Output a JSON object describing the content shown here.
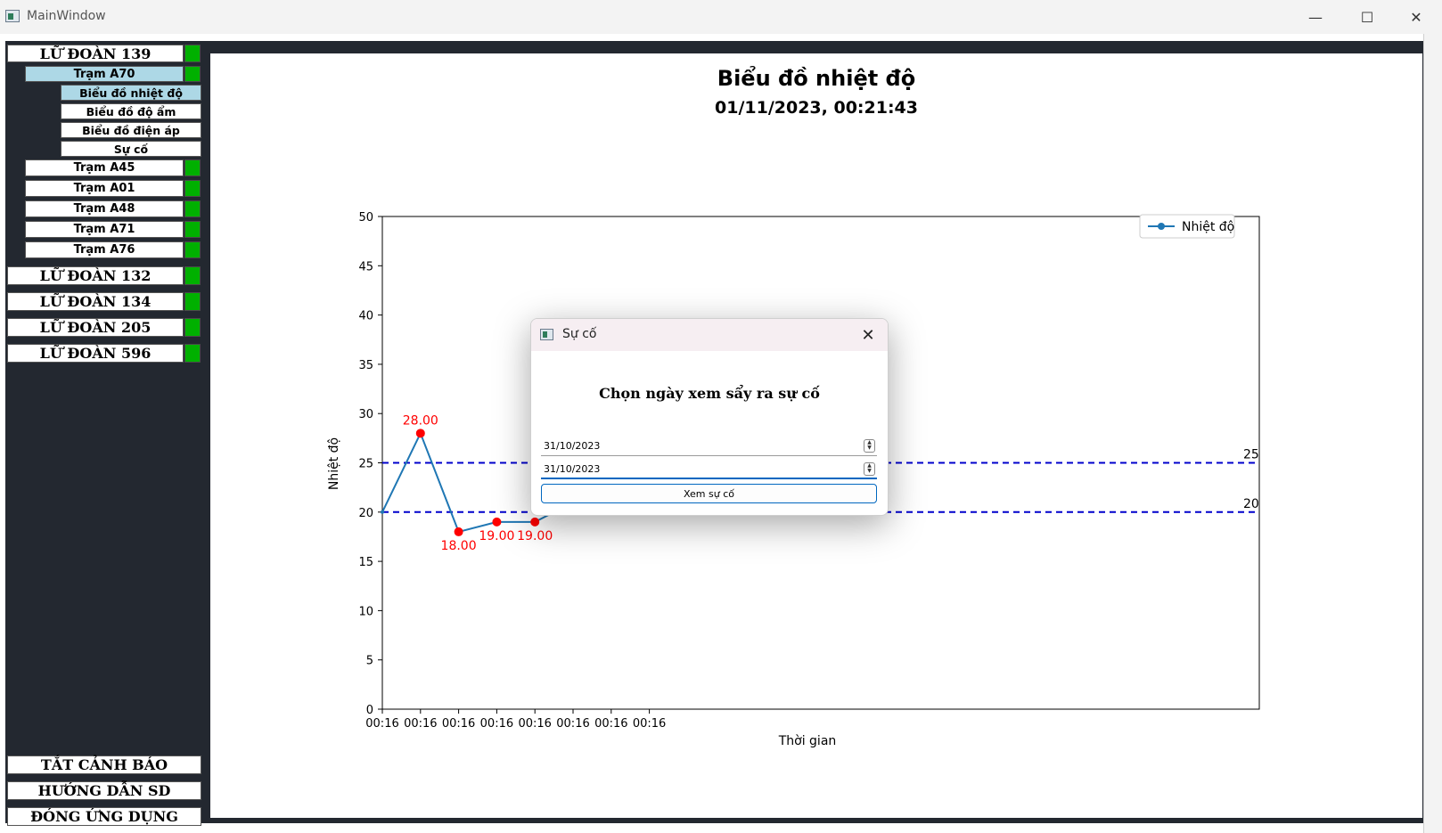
{
  "window": {
    "title": "MainWindow",
    "minimize_icon": "—",
    "maximize_icon": "☐",
    "close_icon": "✕"
  },
  "sidebar": {
    "groups": [
      {
        "label": "LỮ ĐOÀN 139"
      },
      {
        "label": "LỮ ĐOÀN 132"
      },
      {
        "label": "LỮ ĐOÀN 134"
      },
      {
        "label": "LỮ ĐOÀN 205"
      },
      {
        "label": "LỮ ĐOÀN 596"
      }
    ],
    "stations": [
      {
        "label": "Trạm A70"
      },
      {
        "label": "Trạm A45"
      },
      {
        "label": "Trạm A01"
      },
      {
        "label": "Trạm A48"
      },
      {
        "label": "Trạm A71"
      },
      {
        "label": "Trạm A76"
      }
    ],
    "sub_items": [
      {
        "label": "Biểu đồ nhiệt độ"
      },
      {
        "label": "Biểu đồ độ ẩm"
      },
      {
        "label": "Biểu đồ điện áp"
      },
      {
        "label": "Sự cố"
      }
    ],
    "bottom": {
      "alarm_off": "TẮT CẢNH BÁO",
      "guide": "HƯỚNG DẪN SD",
      "close_app": "ĐÓNG ỨNG DỤNG"
    },
    "status_color": "#00b000",
    "selected_color": "#add8e6"
  },
  "chart_data": {
    "type": "line",
    "title": "Biểu đồ nhiệt độ",
    "subtitle": "01/11/2023, 00:21:43",
    "xlabel": "Thời gian",
    "ylabel": "Nhiệt độ",
    "ylim": [
      0,
      50
    ],
    "yticks": [
      "0",
      "5",
      "10",
      "15",
      "20",
      "25",
      "30",
      "35",
      "40",
      "45",
      "50"
    ],
    "categories": [
      "00:16",
      "00:16",
      "00:16",
      "00:16",
      "00:16",
      "00:16",
      "00:16",
      "00:16"
    ],
    "series": [
      {
        "name": "Nhiệt độ",
        "values": [
          20,
          28,
          18,
          19,
          19,
          21
        ],
        "color": "#1f77b4"
      }
    ],
    "highlight_points": [
      {
        "index": 1,
        "value": 28,
        "label": "28.00"
      },
      {
        "index": 2,
        "value": 18,
        "label": "18.00"
      },
      {
        "index": 3,
        "value": 19,
        "label": "19.00"
      },
      {
        "index": 4,
        "value": 19,
        "label": "19.00"
      }
    ],
    "highlight_color": "#ff0000",
    "thresholds": [
      {
        "value": 25,
        "label": "25"
      },
      {
        "value": 20,
        "label": "20"
      }
    ],
    "threshold_color": "#0000cc",
    "legend_position": "top-right",
    "grid": false
  },
  "dialog": {
    "title": "Sự cố",
    "close_icon": "✕",
    "heading": "Chọn ngày xem sẩy ra sự cố",
    "from_date": "31/10/2023",
    "to_date": "31/10/2023",
    "submit_label": "Xem sự cố"
  }
}
